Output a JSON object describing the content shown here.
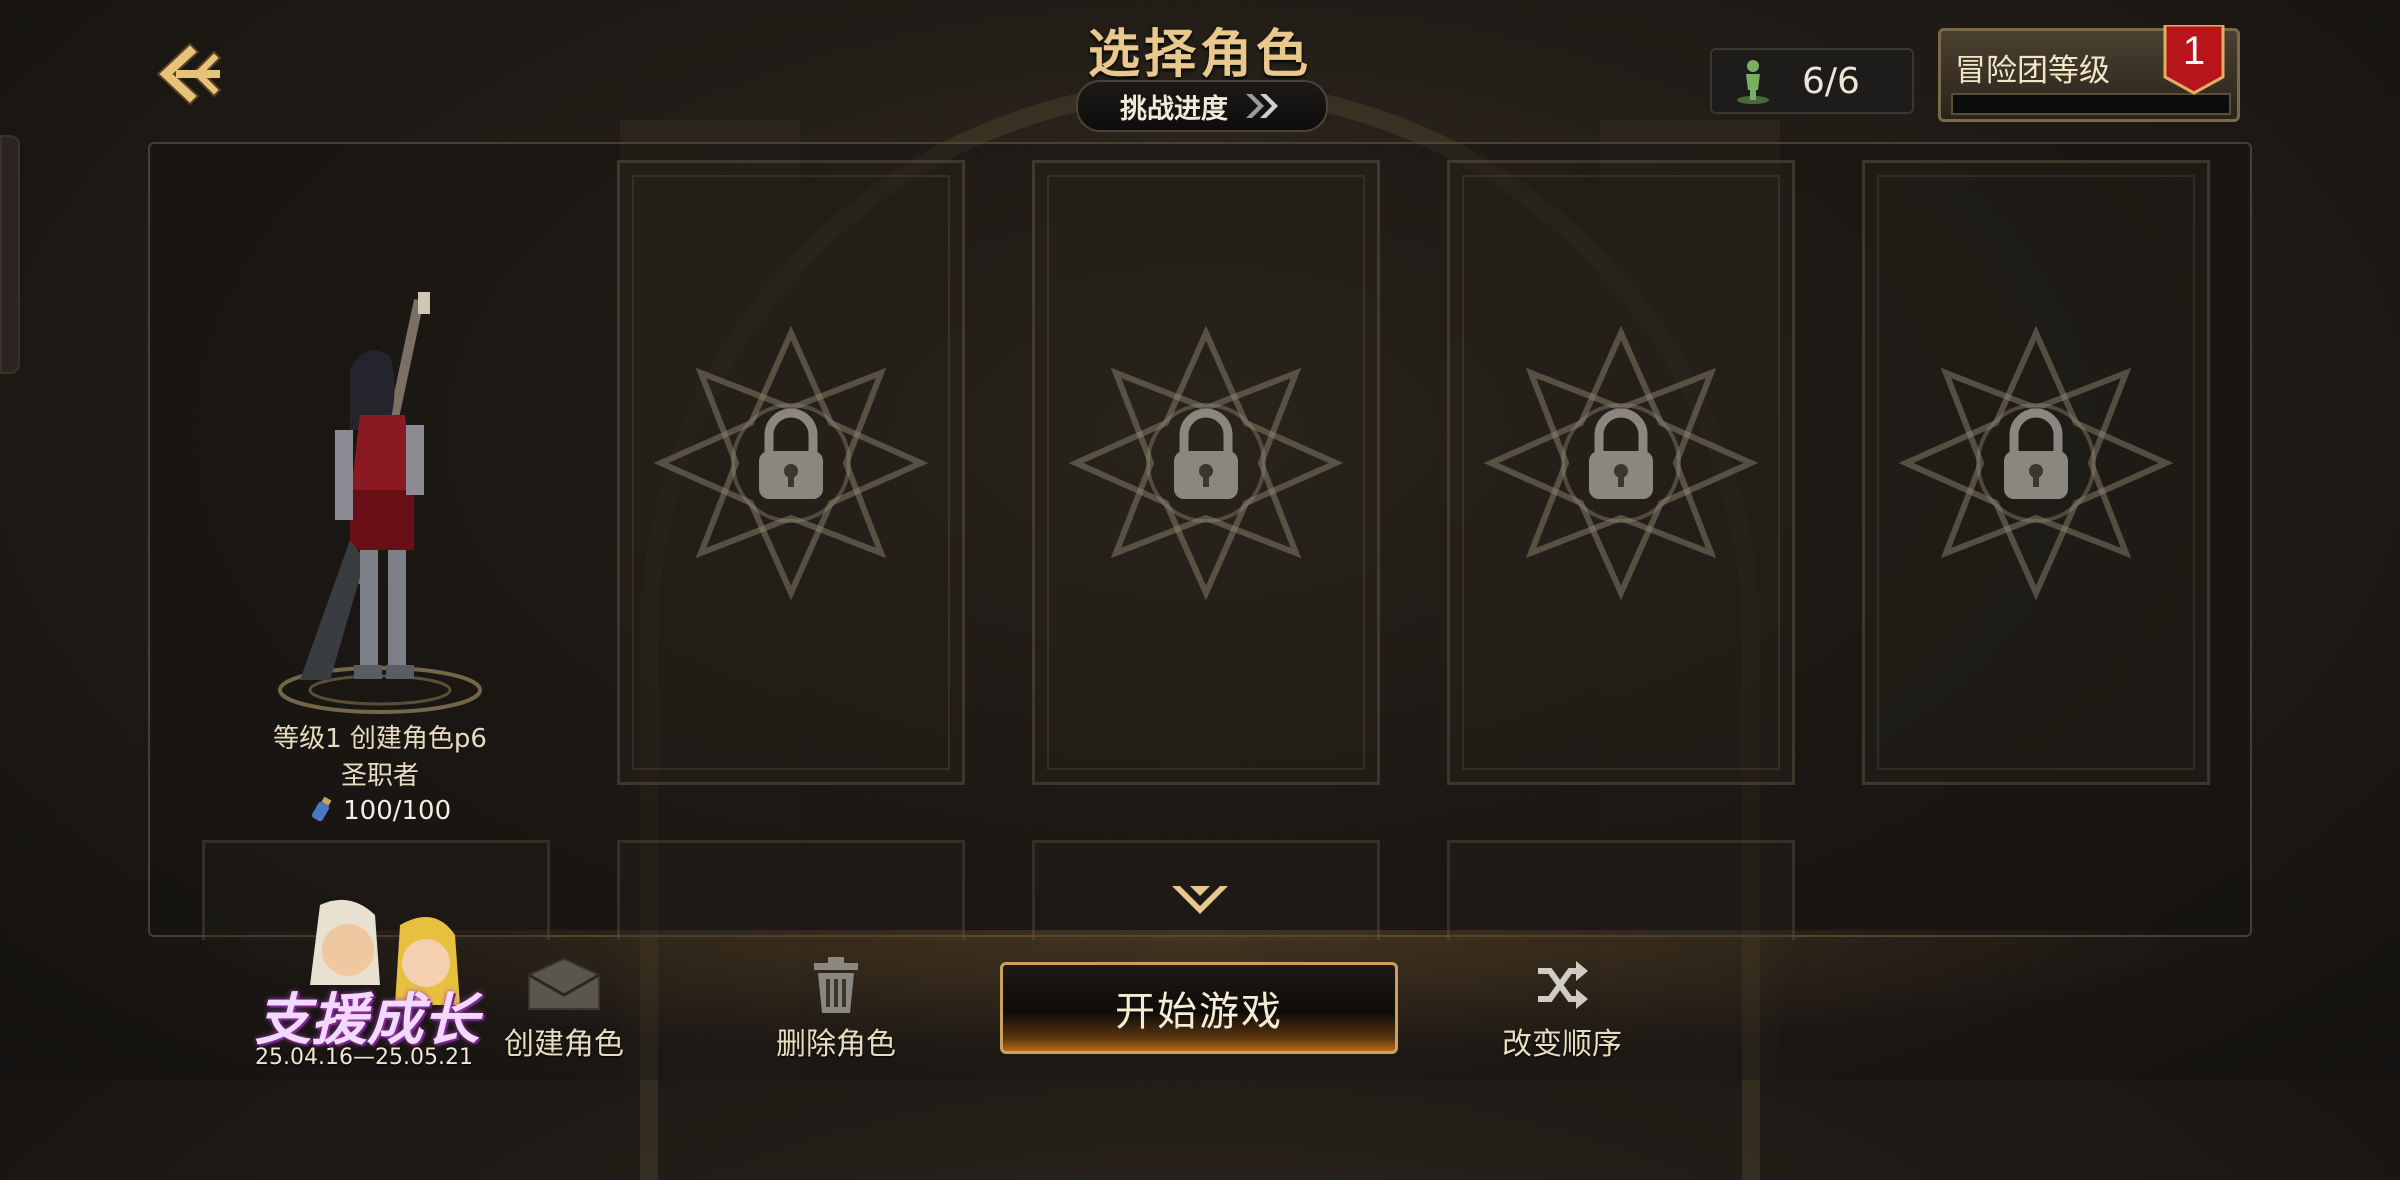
{
  "header": {
    "title": "选择角色",
    "challenge_label": "挑战进度",
    "slots_count": "6/6",
    "adventure_label": "冒险团等级",
    "adventure_level": "1",
    "adventure_progress": 0
  },
  "character": {
    "name": "等级1 创建角色p6",
    "class": "圣职者",
    "fatigue": "100/100"
  },
  "locked_slots": 4,
  "bottom": {
    "event_title": "支援成长",
    "event_date": "25.04.16—25.05.21",
    "create_label": "创建角色",
    "delete_label": "删除角色",
    "start_label": "开始游戏",
    "reorder_label": "改变顺序"
  },
  "icons": [
    "back-arrow-icon",
    "person-icon",
    "chevron-double-right-icon",
    "lock-icon",
    "chevron-down-icon",
    "envelope-icon",
    "trash-icon",
    "shuffle-icon",
    "fatigue-potion-icon"
  ],
  "colors": {
    "accent": "#c9a060",
    "title": "#e8c88c",
    "badge_red": "#b8141c"
  }
}
